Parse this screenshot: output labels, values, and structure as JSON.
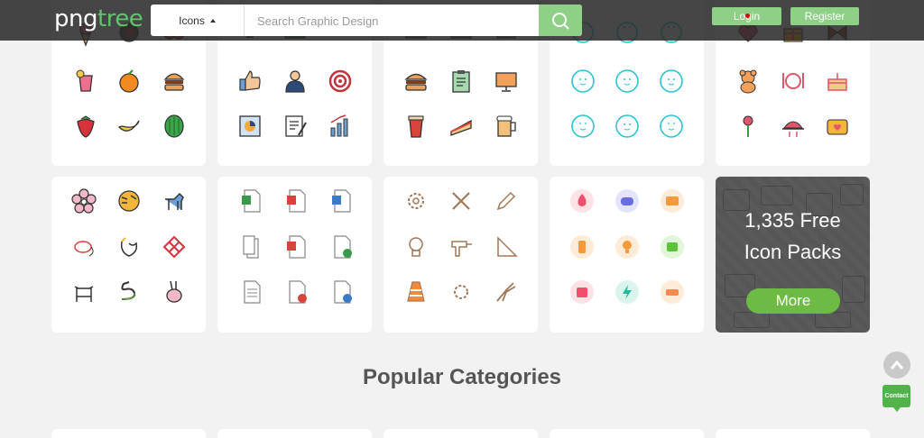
{
  "header": {
    "logo_png": "png",
    "logo_tree": "tree",
    "search_type": "Icons",
    "search_placeholder": "Search Graphic Design",
    "login": "Login",
    "register": "Register"
  },
  "cards": [
    {
      "theme": "food",
      "icons": [
        "ice-cream-icon",
        "coffee-cup-icon",
        "cherry-icon",
        "cocktail-icon",
        "orange-icon",
        "burger-icon",
        "strawberry-icon",
        "banana-icon",
        "watermelon-icon"
      ]
    },
    {
      "theme": "business",
      "icons": [
        "bulb-icon",
        "money-icon",
        "handshake-icon",
        "thumbs-up-icon",
        "businessman-icon",
        "target-icon",
        "report-icon",
        "contract-icon",
        "growth-chart-icon"
      ]
    },
    {
      "theme": "fast-food",
      "icons": [
        "camera-icon",
        "video-icon",
        "gift-box-icon",
        "burger-icon",
        "clipboard-icon",
        "monitor-icon",
        "coffee-cup-icon",
        "sandwich-icon",
        "beer-mug-icon"
      ]
    },
    {
      "theme": "faces",
      "icons": [
        "face-icon",
        "face-icon",
        "face-icon",
        "face-icon",
        "face-icon",
        "face-icon",
        "face-icon",
        "face-icon",
        "face-icon"
      ]
    },
    {
      "theme": "romance",
      "icons": [
        "heart-icon",
        "gift-icon",
        "bow-icon",
        "teddy-bear-icon",
        "dinner-plate-icon",
        "cake-icon",
        "rose-icon",
        "cloche-icon",
        "love-camera-icon"
      ]
    },
    {
      "theme": "zodiac",
      "icons": [
        "flower-icon",
        "tiger-icon",
        "dog-icon",
        "rat-icon",
        "rooster-icon",
        "knot-icon",
        "ox-icon",
        "snake-icon",
        "rabbit-icon"
      ]
    },
    {
      "theme": "documents",
      "icons": [
        "excel-file-icon",
        "pdf-file-icon",
        "word-file-icon",
        "copy-file-icon",
        "ppt-file-icon",
        "checked-file-icon",
        "text-file-icon",
        "delete-file-icon",
        "download-file-icon"
      ]
    },
    {
      "theme": "tools",
      "icons": [
        "gear-icon",
        "wrench-screwdriver-icon",
        "pencil-icon",
        "bulb-icon",
        "drill-icon",
        "set-square-icon",
        "traffic-cone-icon",
        "cog-icon",
        "pliers-icon"
      ]
    },
    {
      "theme": "ui-round",
      "icons": [
        "fire-icon",
        "gamepad-icon",
        "card-icon",
        "phone-icon",
        "bulb-icon",
        "tv-icon",
        "wallet-icon",
        "bolt-icon",
        "car-icon"
      ]
    }
  ],
  "promo": {
    "line1": "1,335 Free",
    "line2": "Icon Packs",
    "button": "More"
  },
  "section_title": "Popular Categories",
  "widgets": {
    "contact": "Contact"
  }
}
